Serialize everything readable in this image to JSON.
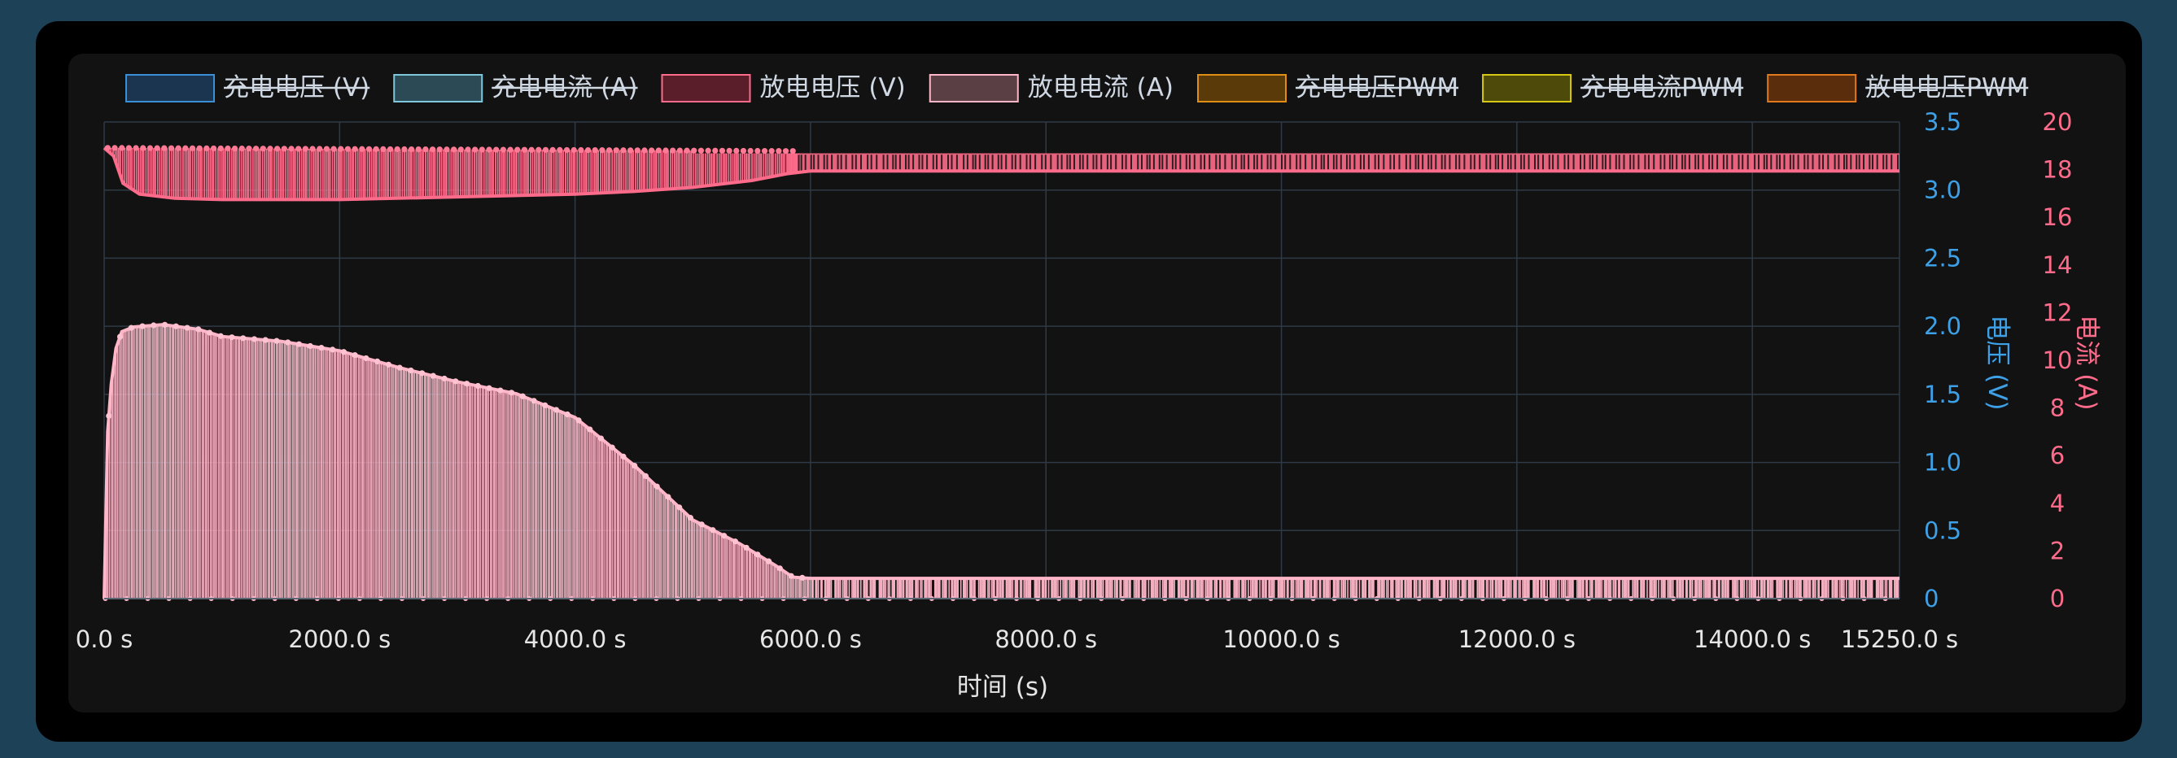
{
  "chart_data": {
    "type": "line",
    "title": "",
    "xlabel": "时间 (s)",
    "ylabel_left": "电压 (V)",
    "ylabel_right": "电流 (A)",
    "xlim": [
      0,
      15250
    ],
    "ylim_left": [
      0,
      3.5
    ],
    "ylim_right": [
      0,
      20
    ],
    "x_ticks": [
      "0.0 s",
      "2000.0 s",
      "4000.0 s",
      "6000.0 s",
      "8000.0 s",
      "10000.0 s",
      "12000.0 s",
      "14000.0 s",
      "15250.0 s"
    ],
    "x_tick_values": [
      0,
      2000,
      4000,
      6000,
      8000,
      10000,
      12000,
      14000,
      15250
    ],
    "y_left_ticks": [
      "0",
      "0.5",
      "1.0",
      "1.5",
      "2.0",
      "2.5",
      "3.0",
      "3.5"
    ],
    "y_left_tick_values": [
      0,
      0.5,
      1.0,
      1.5,
      2.0,
      2.5,
      3.0,
      3.5
    ],
    "y_right_ticks": [
      "0",
      "2",
      "4",
      "6",
      "8",
      "10",
      "12",
      "14",
      "16",
      "18",
      "20"
    ],
    "y_right_tick_values": [
      0,
      2,
      4,
      6,
      8,
      10,
      12,
      14,
      16,
      18,
      20
    ],
    "grid": true,
    "legend_position": "top",
    "legend": [
      {
        "label": "充电电压 (V)",
        "hidden": true,
        "fill": "#1b3550",
        "stroke": "#3a8fd6"
      },
      {
        "label": "充电电流 (A)",
        "hidden": true,
        "fill": "#2b4a55",
        "stroke": "#7fc8dc"
      },
      {
        "label": "放电电压 (V)",
        "hidden": false,
        "fill": "#5a1e2b",
        "stroke": "#ff6b8a"
      },
      {
        "label": "放电电流 (A)",
        "hidden": false,
        "fill": "#5a3f45",
        "stroke": "#ffb6c8"
      },
      {
        "label": "充电电压PWM",
        "hidden": true,
        "fill": "#5a3a08",
        "stroke": "#e08f16"
      },
      {
        "label": "充电电流PWM",
        "hidden": true,
        "fill": "#4e4b0a",
        "stroke": "#d8c816"
      },
      {
        "label": "放电电压PWM",
        "hidden": true,
        "fill": "#5a2e0c",
        "stroke": "#e07a1c"
      }
    ],
    "series": [
      {
        "name": "放电电压 (V)",
        "axis": "left",
        "color": "#ff6b8a",
        "points": [
          [
            0,
            3.31
          ],
          [
            80,
            3.25
          ],
          [
            160,
            3.05
          ],
          [
            300,
            2.97
          ],
          [
            600,
            2.94
          ],
          [
            1000,
            2.93
          ],
          [
            1500,
            2.93
          ],
          [
            2000,
            2.93
          ],
          [
            3000,
            2.95
          ],
          [
            4000,
            2.97
          ],
          [
            4500,
            2.99
          ],
          [
            5000,
            3.02
          ],
          [
            5500,
            3.07
          ],
          [
            5800,
            3.12
          ],
          [
            6000,
            3.14
          ],
          [
            15250,
            3.14
          ]
        ],
        "pulse_top": 3.31,
        "pulse_top_late": 3.27,
        "pulse_low_late": 3.13
      },
      {
        "name": "放电电流 (A)",
        "axis": "right",
        "color": "#ffb6c8",
        "points": [
          [
            0,
            0
          ],
          [
            30,
            7
          ],
          [
            60,
            9
          ],
          [
            100,
            10.5
          ],
          [
            150,
            11.2
          ],
          [
            250,
            11.4
          ],
          [
            500,
            11.5
          ],
          [
            800,
            11.3
          ],
          [
            1000,
            11.0
          ],
          [
            1500,
            10.8
          ],
          [
            2000,
            10.4
          ],
          [
            2500,
            9.7
          ],
          [
            3000,
            9.1
          ],
          [
            3500,
            8.6
          ],
          [
            4000,
            7.6
          ],
          [
            4500,
            5.6
          ],
          [
            5000,
            3.3
          ],
          [
            5400,
            2.3
          ],
          [
            5700,
            1.4
          ],
          [
            5850,
            0.9
          ],
          [
            6000,
            0.85
          ],
          [
            15250,
            0.85
          ]
        ],
        "pulse_low": 0
      }
    ]
  }
}
